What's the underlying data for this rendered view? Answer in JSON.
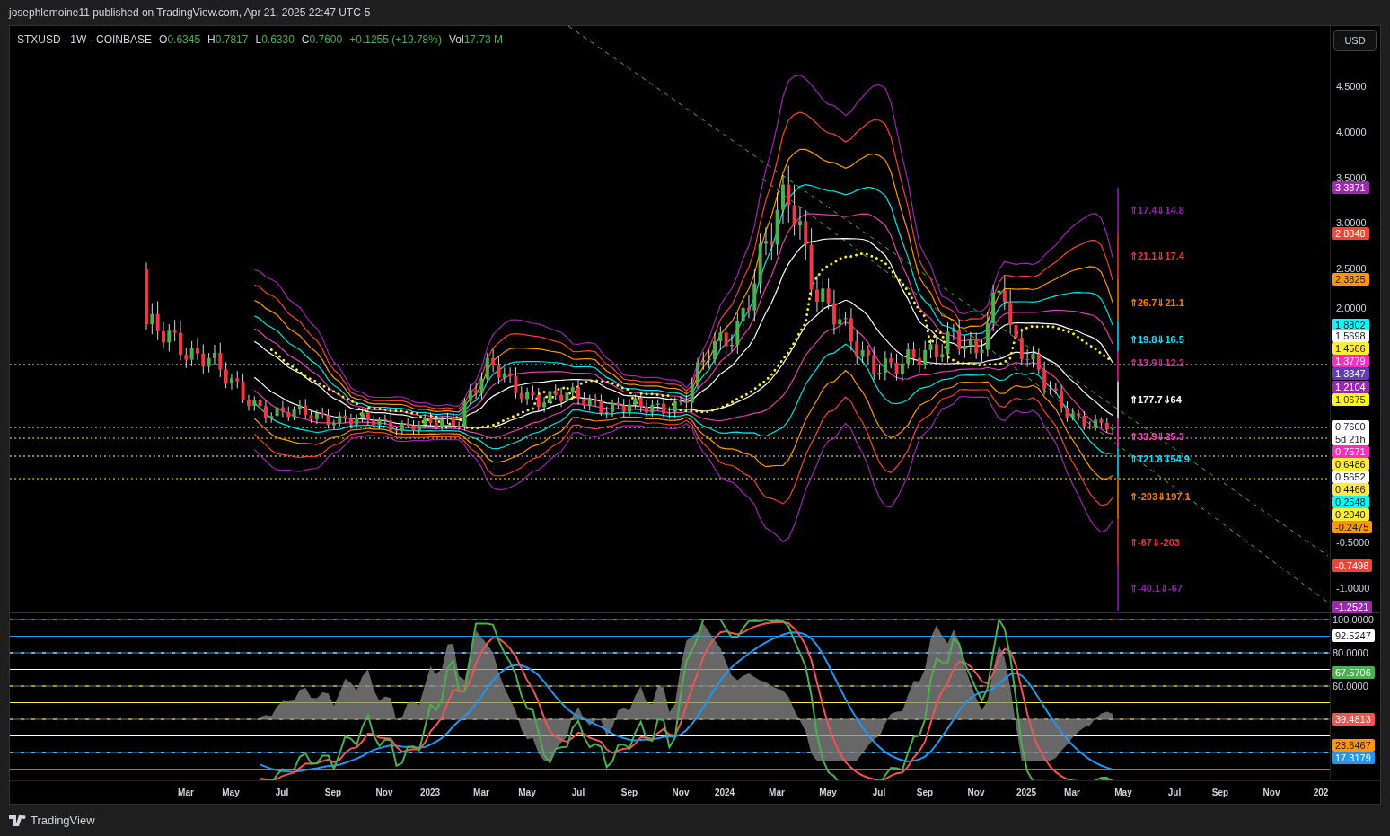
{
  "attribution": "josephlemoine11 published on TradingView.com, Apr 21, 2025 22:47 UTC-5",
  "legend": {
    "symbol": "STXUSD · 1W · COINBASE",
    "values": [
      {
        "label": "O",
        "value": "0.6345"
      },
      {
        "label": "H",
        "value": "0.7817"
      },
      {
        "label": "L",
        "value": "0.6330"
      },
      {
        "label": "C",
        "value": "0.7600"
      }
    ],
    "change": "+0.1255 (+19.78%)",
    "volume_label": "Vol",
    "volume": "17.73 M"
  },
  "currency_button": "USD",
  "fib_labels": [
    {
      "text": "⇑17.4⇓14.8",
      "color": "#8e24aa"
    },
    {
      "text": "⇑21.1⇓17.4",
      "color": "#e53935"
    },
    {
      "text": "⇑26.7⇓21.1",
      "color": "#f57c00"
    },
    {
      "text": "⇑19.8⇓16.5",
      "color": "#00e5ff"
    },
    {
      "text": "⇑13.9⇓12.2",
      "color": "#e91e9c"
    },
    {
      "text": "⇑177.7⇓64",
      "color": "#ffffff"
    },
    {
      "text": "⇑33.9⇓25.3",
      "color": "#ff40c0"
    },
    {
      "text": "⇑121.8⇓54.9",
      "color": "#00e5ff"
    },
    {
      "text": "⇑-203⇓197.1",
      "color": "#f57c00"
    },
    {
      "text": "⇑-67⇓-203",
      "color": "#e53935"
    },
    {
      "text": "⇑-40.1⇓-67",
      "color": "#8e24aa"
    }
  ],
  "price_axis": {
    "ticks": [
      "4.5000",
      "4.0000",
      "3.5000",
      "3.0000",
      "2.5000",
      "2.0000",
      "-0.5000",
      "-1.0000"
    ],
    "tags": [
      {
        "text": "3.3871",
        "color": "#9c27b0"
      },
      {
        "text": "2.8848",
        "color": "#f44336"
      },
      {
        "text": "2.3825",
        "color": "#ff9800"
      },
      {
        "text": "1.8802",
        "color": "#00ffff"
      },
      {
        "text": "1.5698",
        "color": "#ffffff"
      },
      {
        "text": "1.4566",
        "color": "#ffeb3b"
      },
      {
        "text": "1.3779",
        "color": "#ff2cc0"
      },
      {
        "text": "1.3347",
        "color": "#673ab7"
      },
      {
        "text": "1.2104",
        "color": "#9c27b0"
      },
      {
        "text": "1.0675",
        "color": "#ffff00"
      },
      {
        "text": "0.7600",
        "color": "#ffffff",
        "countdown": "5d 21h"
      },
      {
        "text": "0.7571",
        "color": "#ff2cc0"
      },
      {
        "text": "0.6486",
        "color": "#ffeb3b"
      },
      {
        "text": "0.5652",
        "color": "#ffffff"
      },
      {
        "text": "0.4466",
        "color": "#ffeb3b"
      },
      {
        "text": "0.2548",
        "color": "#00ffff"
      },
      {
        "text": "0.2040",
        "color": "#ffeb3b"
      },
      {
        "text": "-0.2475",
        "color": "#ff9800"
      },
      {
        "text": "-0.7498",
        "color": "#f44336"
      },
      {
        "text": "-1.2521",
        "color": "#9c27b0"
      }
    ]
  },
  "oscillator_axis": {
    "ticks": [
      "100.0000",
      "80.0000",
      "60.0000"
    ],
    "tags": [
      {
        "text": "92.5247",
        "color": "#ffffff"
      },
      {
        "text": "67.5706",
        "color": "#4caf50"
      },
      {
        "text": "39.4813",
        "color": "#f05454"
      },
      {
        "text": "23.6467",
        "color": "#ff9800"
      },
      {
        "text": "17.3179",
        "color": "#2196f3"
      }
    ]
  },
  "time_axis": [
    "Mar",
    "May",
    "Jul",
    "Sep",
    "Nov",
    "2023",
    "Mar",
    "May",
    "Jul",
    "Sep",
    "Nov",
    "2024",
    "Mar",
    "May",
    "Jul",
    "Sep",
    "Nov",
    "2025",
    "Mar",
    "May",
    "Jul",
    "Sep",
    "Nov",
    "202"
  ],
  "footer": {
    "brand": "TradingView"
  }
}
